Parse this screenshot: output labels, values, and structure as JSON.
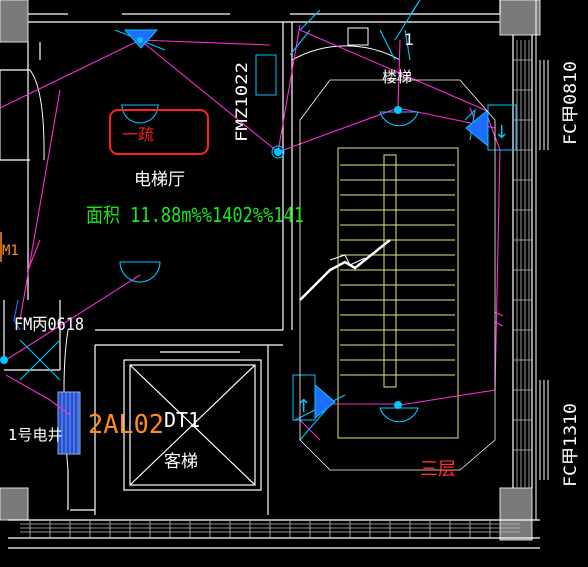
{
  "labels": {
    "elevator_hall": "电梯厅",
    "area_text": "面积 11.88m%%1402%%141",
    "marker_box": "一疏",
    "stairs": "楼梯",
    "stair_number": "1",
    "door_fm": "FMZ1022",
    "door_fm_small": "FM丙0618",
    "window_top": "FC甲0810",
    "window_bottom": "FC甲1310",
    "equip_code": "2AL02",
    "elevator_code": "DT1",
    "elevator_type": "客梯",
    "shaft": "1号电井",
    "floor_label": "三层",
    "m1": "M1",
    "f_top": "↓",
    "f_mid": "↑"
  },
  "colors": {
    "wall": "#ffffff",
    "conduit": "#ff2bd6",
    "fixture": "#00c8ff",
    "area_text": "#19e619",
    "equip_text": "#ff8a1e",
    "floor_label": "#ff3030",
    "marker_box": "#ff2020",
    "stairs": "#e6e680",
    "lamp_blue": "#1e6dff",
    "door_arc": "#ffffff"
  }
}
